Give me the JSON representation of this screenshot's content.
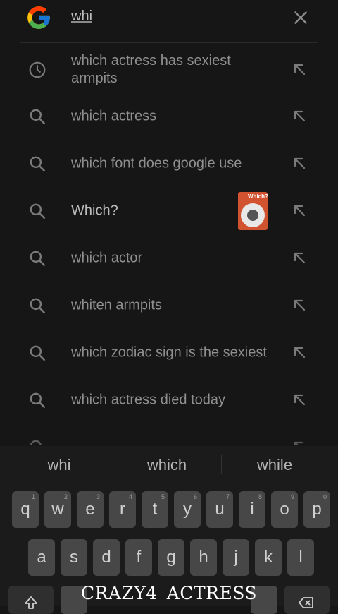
{
  "search": {
    "query": "whi",
    "logo_icon": "google-g-logo",
    "clear_icon": "close-icon"
  },
  "suggestions": [
    {
      "text": "which actress has sexiest armpits",
      "icon": "history-icon",
      "bright": false
    },
    {
      "text": "which actress",
      "icon": "search-icon",
      "bright": false
    },
    {
      "text": "which font does google use",
      "icon": "search-icon",
      "bright": false
    },
    {
      "text": "Which?",
      "icon": "search-icon",
      "bright": true,
      "thumbnail_label": "Which?"
    },
    {
      "text": "which actor",
      "icon": "search-icon",
      "bright": false
    },
    {
      "text": "whiten armpits",
      "icon": "search-icon",
      "bright": false
    },
    {
      "text": "which zodiac sign is the sexiest",
      "icon": "search-icon",
      "bright": false
    },
    {
      "text": "which actress died today",
      "icon": "search-icon",
      "bright": false
    }
  ],
  "keyboard": {
    "predictions": [
      "whi",
      "which",
      "while"
    ],
    "row1": [
      {
        "ch": "q",
        "hint": "1"
      },
      {
        "ch": "w",
        "hint": "2"
      },
      {
        "ch": "e",
        "hint": "3"
      },
      {
        "ch": "r",
        "hint": "4"
      },
      {
        "ch": "t",
        "hint": "5"
      },
      {
        "ch": "y",
        "hint": "6"
      },
      {
        "ch": "u",
        "hint": "7"
      },
      {
        "ch": "i",
        "hint": "8"
      },
      {
        "ch": "o",
        "hint": "9"
      },
      {
        "ch": "p",
        "hint": "0"
      }
    ],
    "row2": [
      "a",
      "s",
      "d",
      "f",
      "g",
      "h",
      "j",
      "k",
      "l"
    ]
  },
  "watermark": "CRAZY4_ACTRESS",
  "colors": {
    "background": "#161616",
    "key": "#474747",
    "text": "#9a9a9a"
  }
}
